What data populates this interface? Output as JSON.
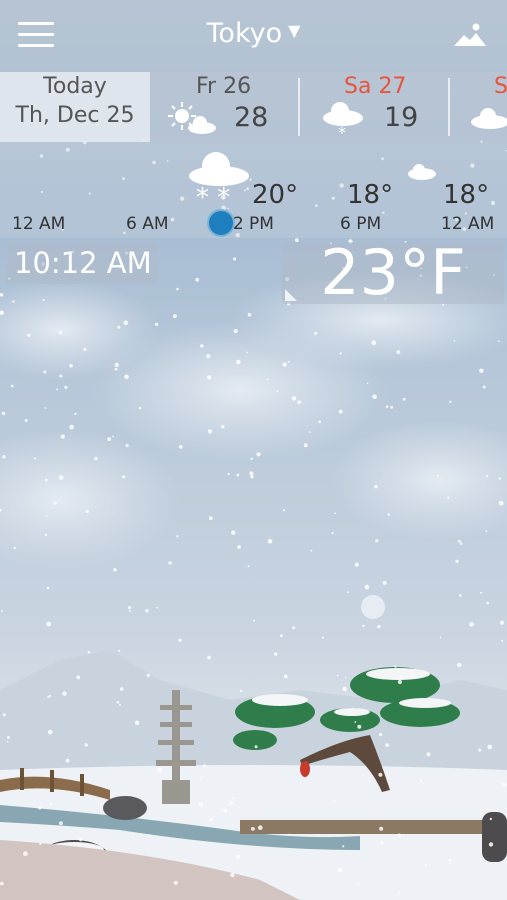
{
  "header": {
    "city": "Tokyo",
    "menu_icon": "hamburger-menu-icon",
    "dropdown_icon": "caret-down-icon",
    "landscape_icon": "mountain-icon"
  },
  "days": {
    "today": {
      "name": "Today",
      "date": "Th, Dec 25"
    },
    "fri": {
      "name": "Fr 26",
      "temp": "28",
      "icon": "sun-cloud-icon"
    },
    "sat": {
      "name": "Sa 27",
      "temp": "19",
      "icon": "snow-cloud-icon",
      "color": "#e8543b"
    },
    "sun_partial": {
      "name": "S",
      "icon": "cloud-icon",
      "color": "#e8543b"
    }
  },
  "hourly": {
    "temps": [
      "20°",
      "18°",
      "18°"
    ],
    "labels": [
      "12 AM",
      "6 AM",
      "12 PM",
      "6 PM",
      "12 AM"
    ],
    "marker_color": "#1f7fbe"
  },
  "current": {
    "time": "10:12 AM",
    "temperature": "23°F"
  },
  "colors": {
    "text_light": "#ffffff",
    "weekend": "#e8543b"
  }
}
